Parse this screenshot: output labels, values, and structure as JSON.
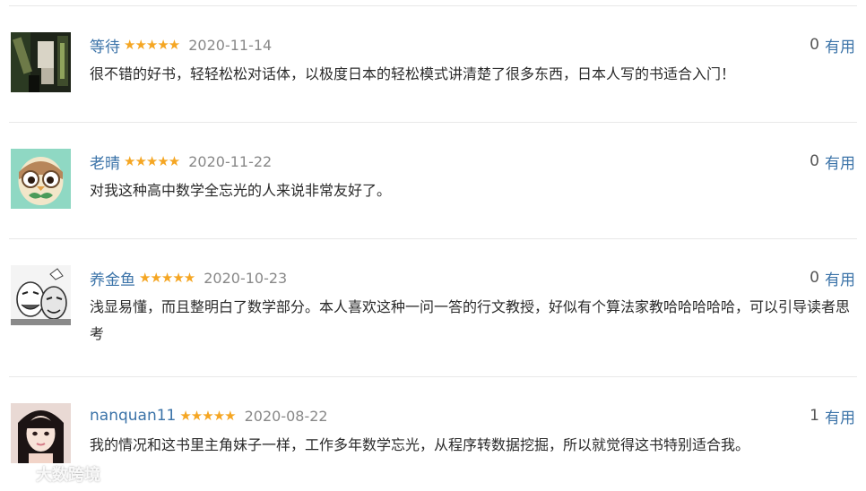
{
  "vote_label": "有用",
  "star_glyph": "★★★★★",
  "colors": {
    "username": "#3b73a8",
    "star": "#f5a623",
    "date": "#888888",
    "vote_link": "#3b73a8",
    "divider": "#e8e8e8"
  },
  "comments": [
    {
      "user": "等待",
      "rating": 5,
      "date": "2020-11-14",
      "votes": "0",
      "text": "很不错的好书，轻轻松松对话体，以极度日本的轻松模式讲清楚了很多东西，日本人写的书适合入门！",
      "avatar": "dark-photo-avatar"
    },
    {
      "user": "老晴",
      "rating": 5,
      "date": "2020-11-22",
      "votes": "0",
      "text": "对我这种高中数学全忘光的人来说非常友好了。",
      "avatar": "owl-cartoon-avatar"
    },
    {
      "user": "养金鱼",
      "rating": 5,
      "date": "2020-10-23",
      "votes": "0",
      "text": "浅显易懂，而且整明白了数学部分。本人喜欢这种一问一答的行文教授，好似有个算法家教哈哈哈哈哈，可以引导读者思考",
      "avatar": "meme-sketch-avatar"
    },
    {
      "user": "nanquan11",
      "rating": 5,
      "date": "2020-08-22",
      "votes": "1",
      "text": "我的情况和这书里主角妹子一样，工作多年数学忘光，从程序转数据挖掘，所以就觉得这书特别适合我。",
      "avatar": "girl-photo-avatar"
    }
  ],
  "watermark": "大数跨境"
}
